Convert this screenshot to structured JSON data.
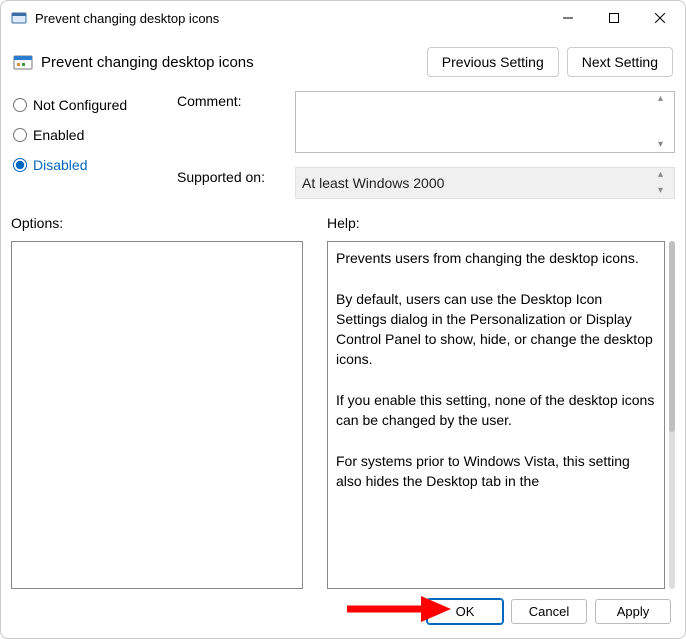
{
  "titlebar": {
    "title": "Prevent changing desktop icons"
  },
  "header": {
    "policy_title": "Prevent changing desktop icons",
    "previous_label": "Previous Setting",
    "next_label": "Next Setting"
  },
  "state": {
    "not_configured_label": "Not Configured",
    "enabled_label": "Enabled",
    "disabled_label": "Disabled",
    "selected": "disabled"
  },
  "fields": {
    "comment_label": "Comment:",
    "comment_value": "",
    "supported_label": "Supported on:",
    "supported_value": "At least Windows 2000"
  },
  "sections": {
    "options_label": "Options:",
    "help_label": "Help:"
  },
  "help_text": "Prevents users from changing the desktop icons.\n\nBy default, users can use the Desktop Icon Settings dialog in the Personalization or Display Control Panel to show, hide, or change the desktop icons.\n\nIf you enable this setting, none of the desktop icons can be changed by the user.\n\nFor systems prior to Windows Vista, this setting also hides the Desktop tab in the",
  "footer": {
    "ok_label": "OK",
    "cancel_label": "Cancel",
    "apply_label": "Apply"
  }
}
